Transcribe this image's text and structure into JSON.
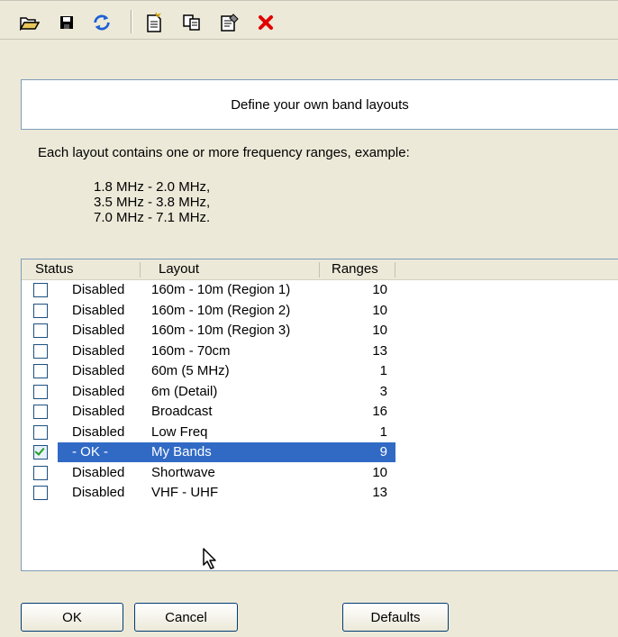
{
  "toolbar": {
    "buttons": [
      {
        "name": "open-folder-icon"
      },
      {
        "name": "save-icon"
      },
      {
        "name": "refresh-icon"
      },
      {
        "name": "new-document-icon"
      },
      {
        "name": "copy-icon"
      },
      {
        "name": "properties-icon"
      },
      {
        "name": "delete-icon"
      }
    ]
  },
  "header": {
    "title": "Define your own band layouts"
  },
  "info": {
    "text": "Each layout contains one or more frequency ranges, example:",
    "examples": [
      "1.8 MHz  -  2.0 MHz,",
      "3.5 MHz  -  3.8 MHz,",
      "7.0 MHz  -  7.1 MHz."
    ]
  },
  "list": {
    "columns": [
      "Status",
      "Layout",
      "Ranges"
    ],
    "rows": [
      {
        "checked": false,
        "status": "Disabled",
        "layout": "160m - 10m (Region 1)",
        "ranges": "10",
        "selected": false
      },
      {
        "checked": false,
        "status": "Disabled",
        "layout": "160m - 10m (Region 2)",
        "ranges": "10",
        "selected": false
      },
      {
        "checked": false,
        "status": "Disabled",
        "layout": "160m - 10m (Region 3)",
        "ranges": "10",
        "selected": false
      },
      {
        "checked": false,
        "status": "Disabled",
        "layout": "160m - 70cm",
        "ranges": "13",
        "selected": false
      },
      {
        "checked": false,
        "status": "Disabled",
        "layout": "60m (5 MHz)",
        "ranges": "1",
        "selected": false
      },
      {
        "checked": false,
        "status": "Disabled",
        "layout": "6m (Detail)",
        "ranges": "3",
        "selected": false
      },
      {
        "checked": false,
        "status": "Disabled",
        "layout": "Broadcast",
        "ranges": "16",
        "selected": false
      },
      {
        "checked": false,
        "status": "Disabled",
        "layout": "Low Freq",
        "ranges": "1",
        "selected": false
      },
      {
        "checked": true,
        "status": "- OK -",
        "layout": "My Bands",
        "ranges": "9",
        "selected": true
      },
      {
        "checked": false,
        "status": "Disabled",
        "layout": "Shortwave",
        "ranges": "10",
        "selected": false
      },
      {
        "checked": false,
        "status": "Disabled",
        "layout": "VHF - UHF",
        "ranges": "13",
        "selected": false
      }
    ]
  },
  "buttons": {
    "ok": "OK",
    "cancel": "Cancel",
    "defaults": "Defaults"
  },
  "colors": {
    "selection": "#316ac5",
    "delete": "#e00000",
    "border": "#7f9db9"
  }
}
